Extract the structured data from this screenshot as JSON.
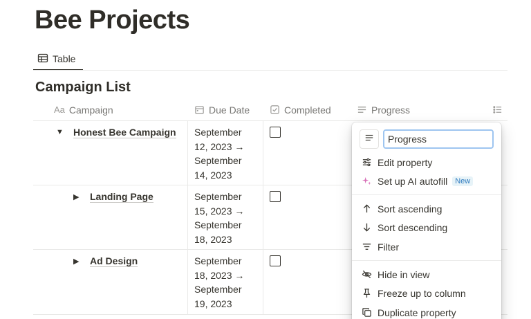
{
  "page": {
    "title": "Bee Projects"
  },
  "views": {
    "active_tab": "Table"
  },
  "database": {
    "title": "Campaign List"
  },
  "columns": [
    {
      "label": "Campaign",
      "icon": "Aa"
    },
    {
      "label": "Due Date",
      "icon": "calendar-icon"
    },
    {
      "label": "Completed",
      "icon": "checkbox-icon"
    },
    {
      "label": "Progress",
      "icon": "text-lines-icon"
    }
  ],
  "rows": [
    {
      "name": "Honest Bee Campaign",
      "toggle": "▼",
      "due_date": [
        "September",
        "12, 2023 →",
        "September",
        "14, 2023"
      ],
      "completed": false
    },
    {
      "name": "Landing Page",
      "toggle": "▶",
      "due_date": [
        "September",
        "15, 2023 →",
        "September",
        "18, 2023"
      ],
      "completed": false
    },
    {
      "name": "Ad Design",
      "toggle": "▶",
      "due_date": [
        "September",
        "18, 2023 →",
        "September",
        "19, 2023"
      ],
      "completed": false
    }
  ],
  "property_menu": {
    "name_value": "Progress",
    "items": [
      {
        "label": "Edit property",
        "icon": "sliders-icon"
      },
      {
        "label": "Set up AI autofill",
        "icon": "sparkle-icon",
        "badge": "New"
      },
      {
        "label": "Sort ascending",
        "icon": "arrow-up-icon"
      },
      {
        "label": "Sort descending",
        "icon": "arrow-down-icon"
      },
      {
        "label": "Filter",
        "icon": "filter-icon"
      },
      {
        "label": "Hide in view",
        "icon": "eye-off-icon"
      },
      {
        "label": "Freeze up to column",
        "icon": "pin-icon"
      },
      {
        "label": "Duplicate property",
        "icon": "copy-icon"
      }
    ]
  },
  "colors": {
    "text": "#37352f",
    "muted": "#787774",
    "border": "#e9e9e7",
    "focus": "#9ec5f0",
    "badge_bg": "#e7f3f8",
    "badge_text": "#2f7bbf",
    "sparkle": "#d86fb8"
  }
}
